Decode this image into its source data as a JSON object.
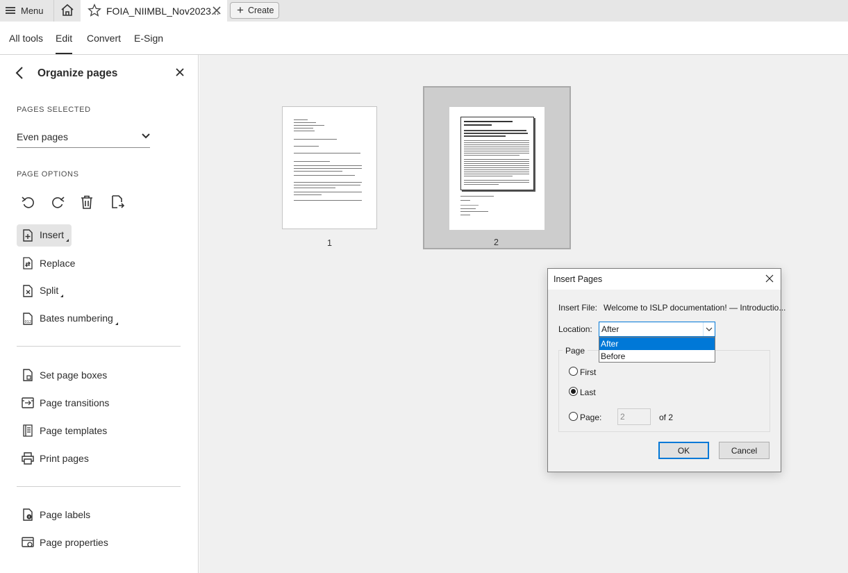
{
  "tabbar": {
    "menu_label": "Menu",
    "doc_tab_name": "FOIA_NIIMBL_Nov2023...",
    "create_label": "Create"
  },
  "toolbar": {
    "items": [
      "All tools",
      "Edit",
      "Convert",
      "E-Sign"
    ],
    "active": "Edit"
  },
  "leftpanel": {
    "title": "Organize pages",
    "pages_selected_label": "PAGES SELECTED",
    "pages_selected_value": "Even pages",
    "page_options_label": "PAGE OPTIONS",
    "option_icons": [
      "rotate-left-icon",
      "rotate-right-icon",
      "delete-icon",
      "extract-pages-icon"
    ],
    "items": [
      {
        "label": "Insert",
        "icon": "insert-page-icon"
      },
      {
        "label": "Replace",
        "icon": "replace-page-icon"
      },
      {
        "label": "Split",
        "icon": "split-icon"
      },
      {
        "label": "Bates numbering",
        "icon": "bates-numbering-icon"
      },
      {
        "label": "Set page boxes",
        "icon": "page-boxes-icon"
      },
      {
        "label": "Page transitions",
        "icon": "page-transitions-icon"
      },
      {
        "label": "Page templates",
        "icon": "page-templates-icon"
      },
      {
        "label": "Print pages",
        "icon": "printer-icon"
      },
      {
        "label": "Page labels",
        "icon": "page-labels-icon"
      },
      {
        "label": "Page properties",
        "icon": "page-properties-icon"
      }
    ]
  },
  "thumbnails": [
    {
      "page": "1",
      "selected": false
    },
    {
      "page": "2",
      "selected": true
    }
  ],
  "dialog": {
    "title": "Insert Pages",
    "insert_file_label": "Insert File:",
    "insert_file_value": "Welcome to ISLP documentation! — Introductio...",
    "location_label": "Location:",
    "location_value": "After",
    "location_options": [
      "After",
      "Before"
    ],
    "page_group_label": "Page",
    "radio_first": "First",
    "radio_last": "Last",
    "radio_page": "Page:",
    "page_input_value": "2",
    "page_of": "of 2",
    "selected_radio": "Last",
    "ok_label": "OK",
    "cancel_label": "Cancel"
  },
  "colors": {
    "accent": "#0078d7",
    "main_bg": "#f0f0f0",
    "tabbar_bg": "#e6e6e6"
  }
}
